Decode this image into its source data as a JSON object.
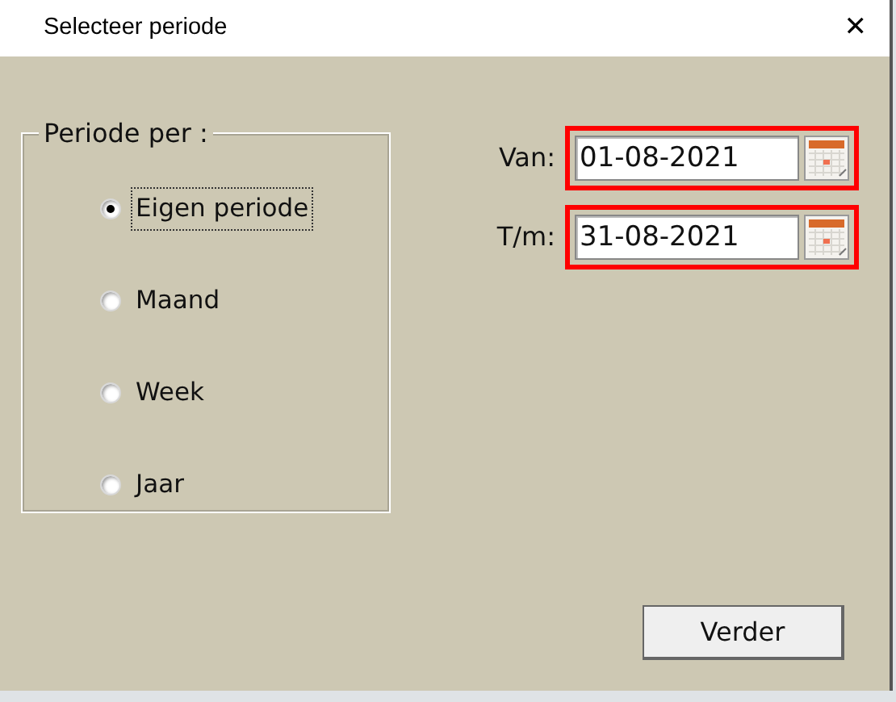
{
  "window": {
    "title": "Selecteer periode",
    "close_glyph": "✕"
  },
  "period_group": {
    "legend": "Periode per :",
    "options": [
      {
        "label": "Eigen periode",
        "selected": true,
        "focused": true
      },
      {
        "label": "Maand",
        "selected": false,
        "focused": false
      },
      {
        "label": "Week",
        "selected": false,
        "focused": false
      },
      {
        "label": "Jaar",
        "selected": false,
        "focused": false
      }
    ]
  },
  "date_fields": [
    {
      "label": "Van:",
      "value": "01-08-2021",
      "highlighted": true
    },
    {
      "label": "T/m:",
      "value": "31-08-2021",
      "highlighted": true
    }
  ],
  "buttons": [
    "Verder"
  ]
}
